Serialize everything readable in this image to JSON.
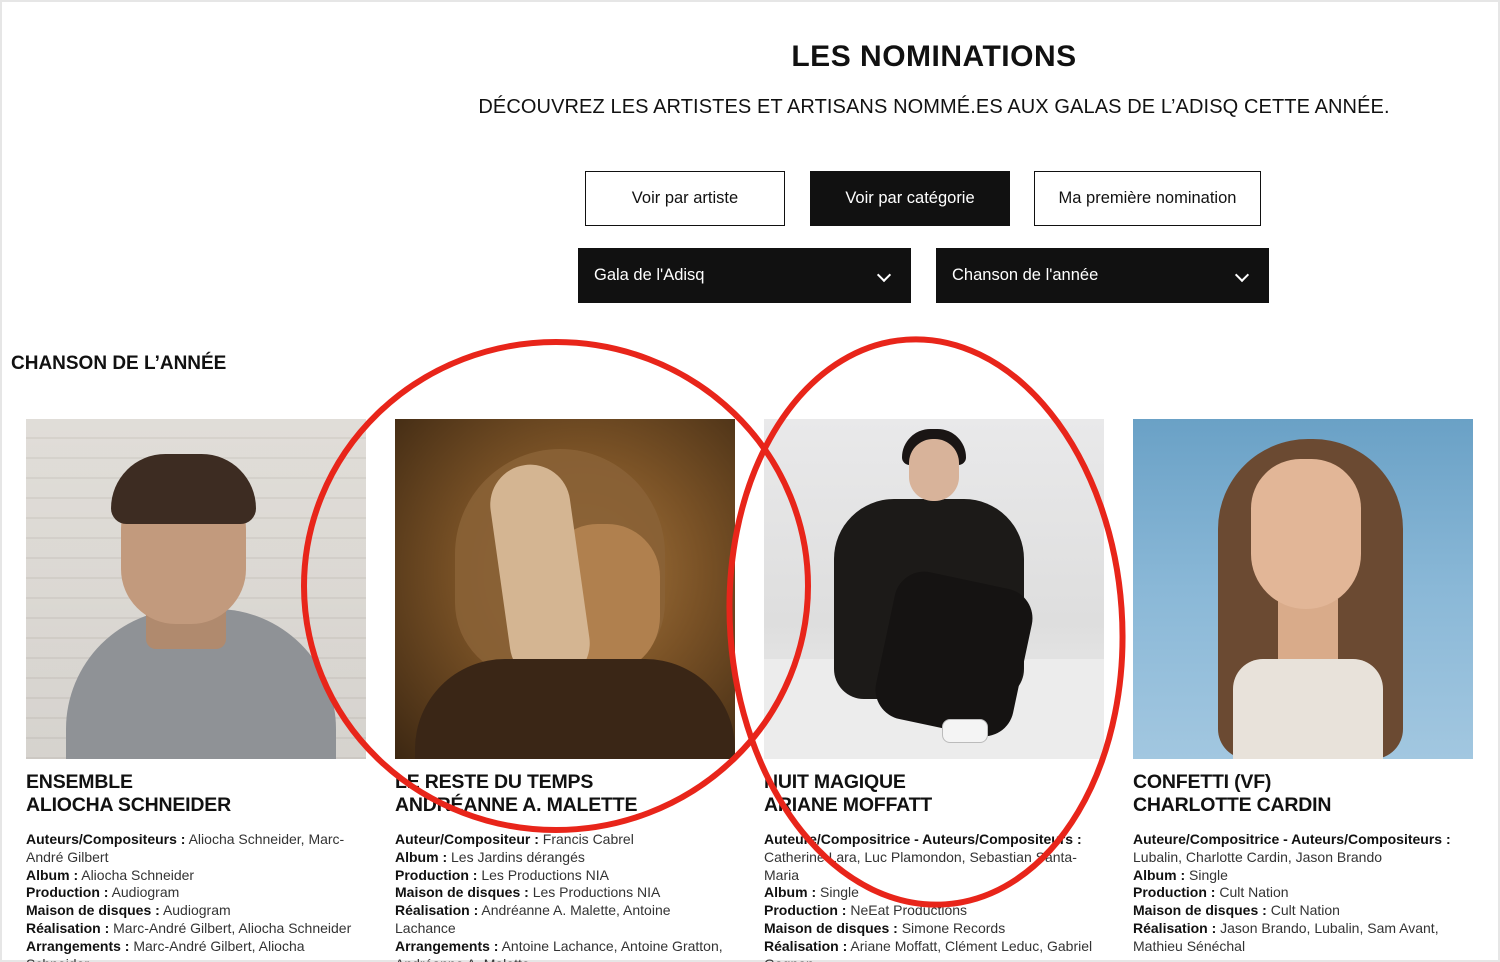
{
  "header": {
    "title": "LES NOMINATIONS",
    "subtitle": "DÉCOUVREZ LES ARTISTES ET ARTISANS NOMMÉ.ES AUX GALAS DE L’ADISQ CETTE ANNÉE."
  },
  "view_buttons": {
    "by_artist": "Voir par artiste",
    "by_category": "Voir par catégorie",
    "first_nomination": "Ma première nomination",
    "active": "by_category"
  },
  "filters": {
    "gala": "Gala de l'Adisq",
    "category": "Chanson de l'année"
  },
  "section": {
    "title": "CHANSON DE L’ANNÉE"
  },
  "nominees": [
    {
      "song": "ENSEMBLE",
      "artist": "ALIOCHA SCHNEIDER",
      "credits": [
        {
          "label": "Auteurs/Compositeurs :",
          "value": "Aliocha Schneider, Marc-André Gilbert"
        },
        {
          "label": "Album :",
          "value": "Aliocha Schneider"
        },
        {
          "label": "Production :",
          "value": "Audiogram"
        },
        {
          "label": "Maison de disques :",
          "value": "Audiogram"
        },
        {
          "label": "Réalisation :",
          "value": "Marc-André Gilbert, Aliocha Schneider"
        },
        {
          "label": "Arrangements :",
          "value": "Marc-André Gilbert, Aliocha Schneider"
        }
      ]
    },
    {
      "song": "LE RESTE DU TEMPS",
      "artist": "ANDRÉANNE A. MALETTE",
      "credits": [
        {
          "label": "Auteur/Compositeur :",
          "value": "Francis Cabrel"
        },
        {
          "label": "Album :",
          "value": "Les Jardins dérangés"
        },
        {
          "label": "Production :",
          "value": "Les Productions NIA"
        },
        {
          "label": "Maison de disques :",
          "value": "Les Productions NIA"
        },
        {
          "label": "Réalisation :",
          "value": "Andréanne A. Malette, Antoine Lachance"
        },
        {
          "label": "Arrangements :",
          "value": "Antoine Lachance, Antoine Gratton, Andréanne A. Malette"
        }
      ]
    },
    {
      "song": "NUIT MAGIQUE",
      "artist": "ARIANE MOFFATT",
      "credits": [
        {
          "label": "Auteure/Compositrice - Auteurs/Compositeurs :",
          "value": "Catherine Lara, Luc Plamondon, Sebastian Santa-Maria"
        },
        {
          "label": "Album :",
          "value": "Single"
        },
        {
          "label": "Production :",
          "value": "NeEat Productions"
        },
        {
          "label": "Maison de disques :",
          "value": "Simone Records"
        },
        {
          "label": "Réalisation :",
          "value": "Ariane Moffatt, Clément Leduc, Gabriel Gagnon"
        }
      ]
    },
    {
      "song": "CONFETTI (VF)",
      "artist": "CHARLOTTE CARDIN",
      "credits": [
        {
          "label": "Auteure/Compositrice - Auteurs/Compositeurs :",
          "value": "Lubalin, Charlotte Cardin, Jason Brando"
        },
        {
          "label": "Album :",
          "value": "Single"
        },
        {
          "label": "Production :",
          "value": "Cult Nation"
        },
        {
          "label": "Maison de disques :",
          "value": "Cult Nation"
        },
        {
          "label": "Réalisation :",
          "value": "Jason Brando, Lubalin, Sam Avant, Mathieu Sénéchal"
        }
      ]
    }
  ],
  "annotation": {
    "color": "#e8251a"
  }
}
